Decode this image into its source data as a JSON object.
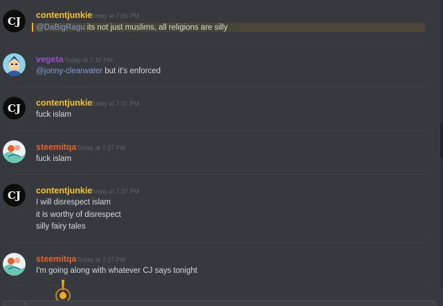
{
  "colors": {
    "background": "#36393e",
    "contentjunkie": "#f6c22e",
    "vegeta": "#9a4ec6",
    "steemitqa": "#e8612c",
    "mention": "#7f9cd9",
    "text": "#d7d8d9",
    "timestamp": "#5f6269",
    "highlight_bar": "#f6b02e"
  },
  "messages": [
    {
      "avatar_icon": "cj-logo-avatar-icon",
      "avatar_text": "CJ",
      "username": "contentjunkie",
      "timestamp": "Today at 7:36 PM",
      "mention": "@DaBigRagu",
      "text": " its not just muslims, all religions are silly"
    },
    {
      "avatar_icon": "vegeta-avatar-icon",
      "username": "vegeta",
      "timestamp": "Today at 7:37 PM",
      "mention": "@jonny-clearwater",
      "text": " but it's enforced"
    },
    {
      "avatar_icon": "cj-logo-avatar-icon",
      "avatar_text": "CJ",
      "username": "contentjunkie",
      "timestamp": "Today at 7:37 PM",
      "text": "fuck islam"
    },
    {
      "avatar_icon": "steemitqa-avatar-icon",
      "username": "steemitqa",
      "timestamp": "Today at 7:37 PM",
      "text": "fuck islam"
    },
    {
      "avatar_icon": "cj-logo-avatar-icon",
      "avatar_text": "CJ",
      "username": "contentjunkie",
      "timestamp": "Today at 7:37 PM",
      "lines": [
        "I will disrespect islam",
        "it is worthy of disrespect",
        "silly fairy tales"
      ]
    },
    {
      "avatar_icon": "steemitqa-avatar-icon",
      "username": "steemitqa",
      "timestamp": "Today at 7:37 PM",
      "text": "I'm going along with whatever CJ says tonight"
    }
  ]
}
